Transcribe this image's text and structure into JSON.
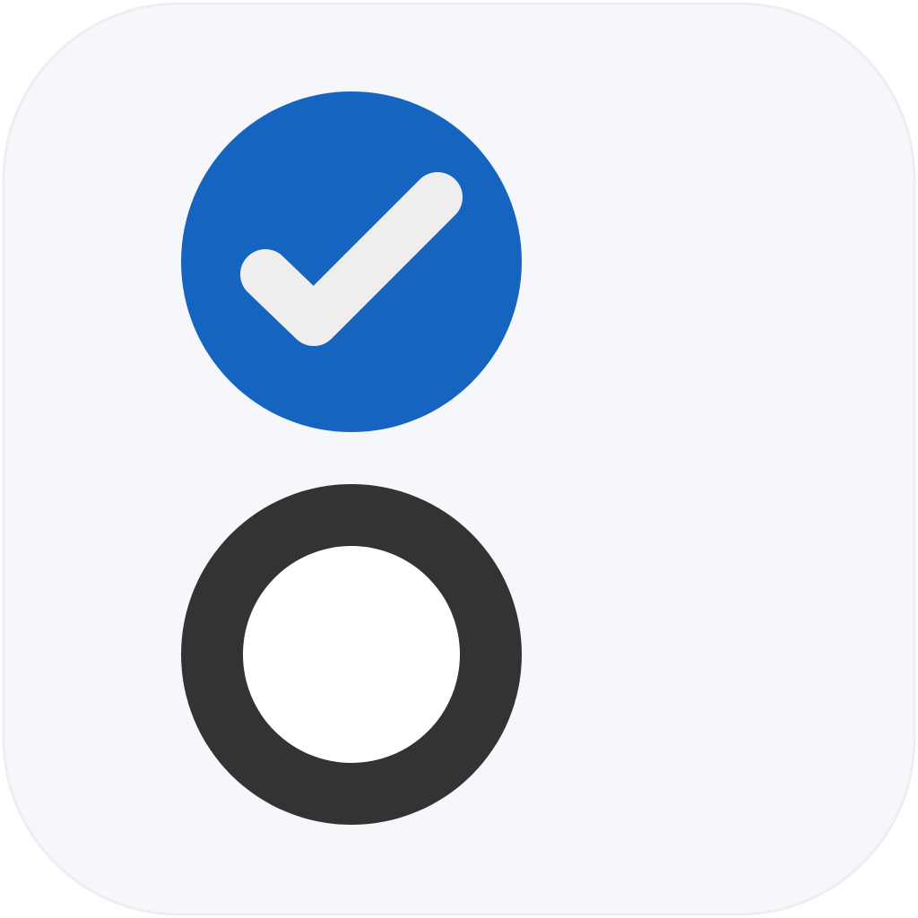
{
  "app_icon": {
    "icon": "checklist-icon",
    "colors": {
      "tile_background": "#f5f7fb",
      "tile_border": "#eceef2",
      "checked_fill": "#1565c0",
      "checkmark": "#eeeeee",
      "unchecked_ring": "#333333",
      "unchecked_center": "#ffffff"
    },
    "items": [
      {
        "icon": "checked-circle-icon",
        "state": "checked"
      },
      {
        "icon": "unchecked-circle-icon",
        "state": "unchecked"
      }
    ]
  }
}
